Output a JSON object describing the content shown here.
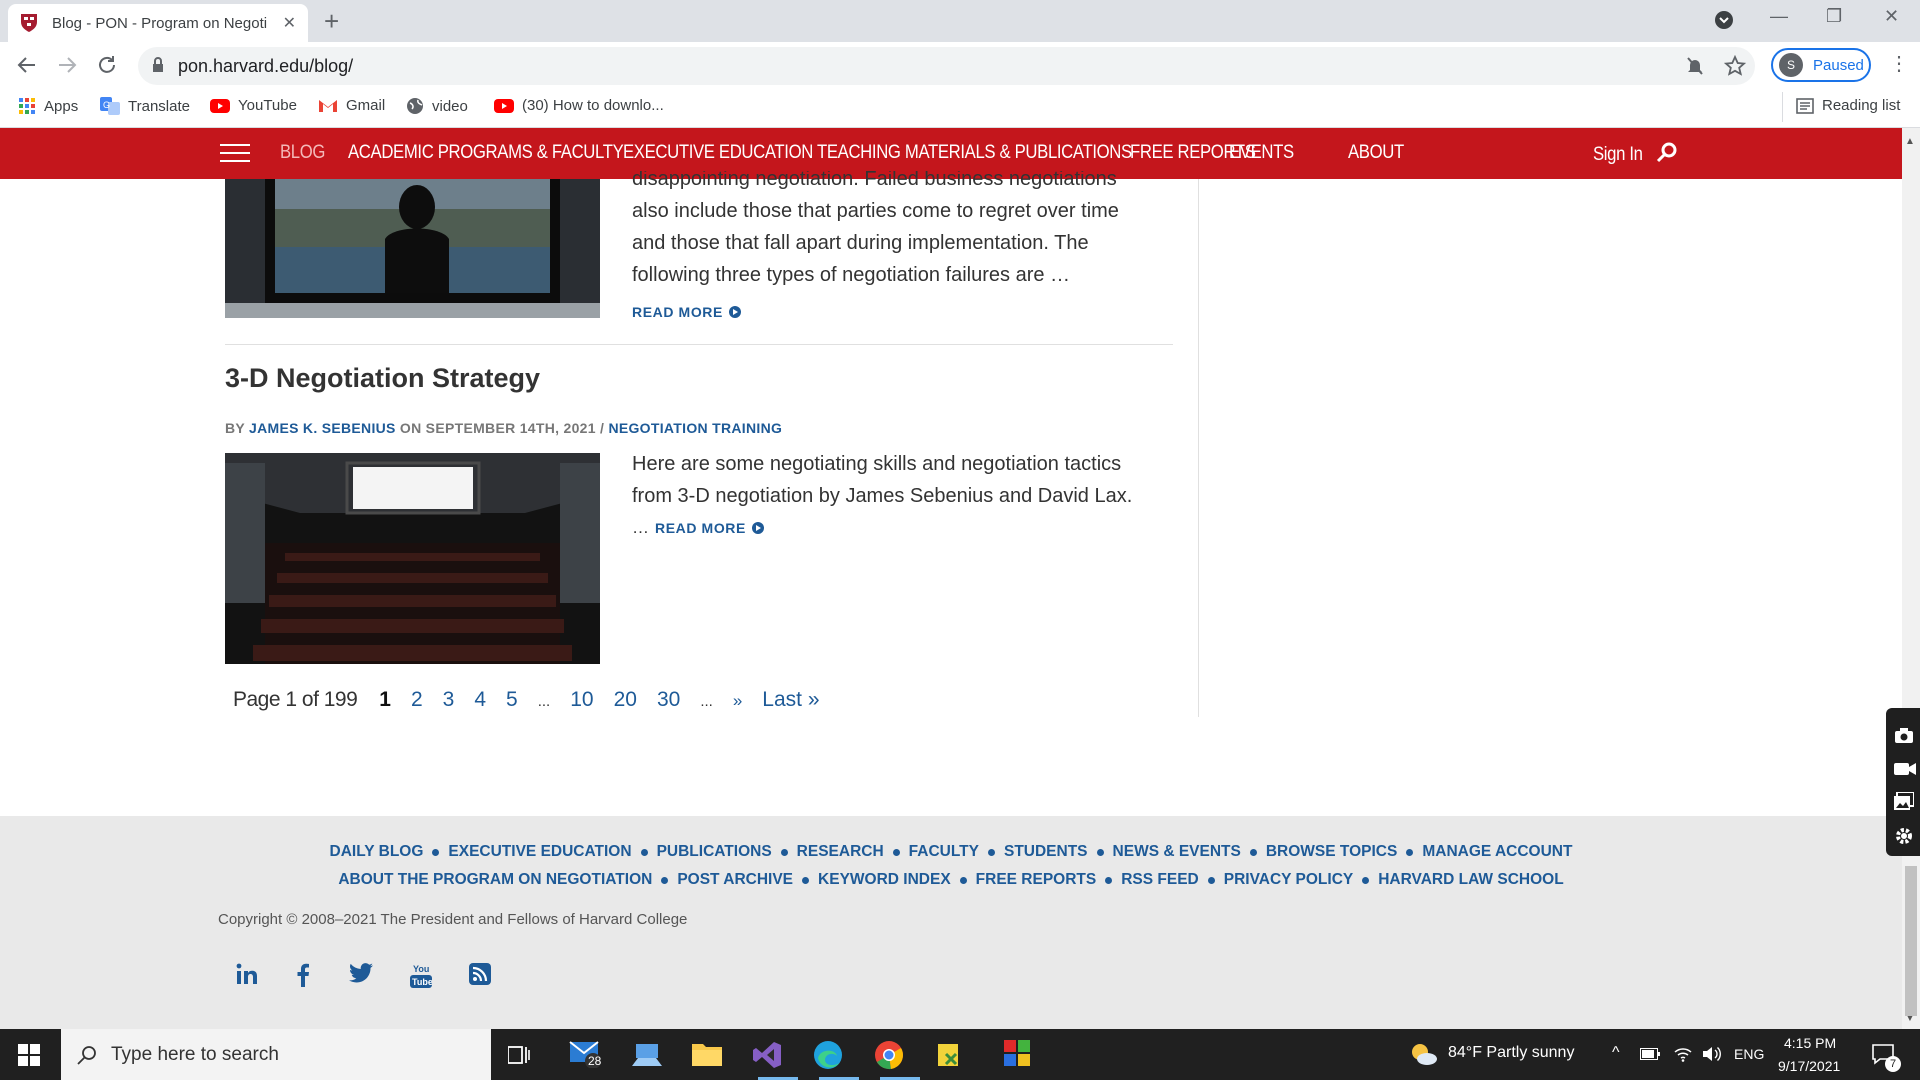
{
  "browser": {
    "tab_title": "Blog - PON - Program on Negoti",
    "url": "pon.harvard.edu/blog/",
    "profile_initial": "S",
    "profile_status": "Paused",
    "bookmarks": [
      "Apps",
      "Translate",
      "YouTube",
      "Gmail",
      "video",
      "(30) How to downlo..."
    ],
    "reading_list": "Reading list"
  },
  "nav": {
    "items": [
      "BLOG",
      "ACADEMIC PROGRAMS & FACULTY",
      "EXECUTIVE EDUCATION",
      "TEACHING MATERIALS & PUBLICATIONS",
      "FREE REPORTS",
      "EVENTS",
      "ABOUT"
    ],
    "sign_in": "Sign In"
  },
  "posts": [
    {
      "excerpt_lines": [
        "disappointing negotiation. Failed business negotiations",
        "also include those that parties come to regret over time",
        "and those that fall apart during implementation. The",
        "following three types of negotiation failures are …"
      ],
      "read_more": "READ MORE"
    },
    {
      "title": "3-D Negotiation Strategy",
      "by": "BY",
      "author": "JAMES K. SEBENIUS",
      "date": "ON SEPTEMBER 14TH, 2021 /",
      "category": "NEGOTIATION TRAINING",
      "excerpt_lines": [
        "Here are some negotiating skills and negotiation tactics",
        "from 3-D negotiation by James Sebenius and David Lax."
      ],
      "ellipsis": "…",
      "read_more": "READ MORE"
    }
  ],
  "pagination": {
    "label": "Page 1 of 199",
    "current": "1",
    "pages": [
      "2",
      "3",
      "4",
      "5"
    ],
    "dots1": "...",
    "jumps": [
      "10",
      "20",
      "30"
    ],
    "dots2": "...",
    "next": "»",
    "last": "Last »"
  },
  "footer": {
    "row1": [
      "DAILY BLOG",
      "EXECUTIVE EDUCATION",
      "PUBLICATIONS",
      "RESEARCH",
      "FACULTY",
      "STUDENTS",
      "NEWS & EVENTS",
      "BROWSE TOPICS",
      "MANAGE ACCOUNT"
    ],
    "row2": [
      "ABOUT THE PROGRAM ON NEGOTIATION",
      "POST ARCHIVE",
      "KEYWORD INDEX",
      "FREE REPORTS",
      "RSS FEED",
      "PRIVACY POLICY",
      "HARVARD LAW SCHOOL"
    ],
    "copyright": "Copyright © 2008–2021 The President and Fellows of Harvard College",
    "social": [
      "linkedin-icon",
      "facebook-icon",
      "twitter-icon",
      "youtube-icon",
      "rss-icon"
    ]
  },
  "taskbar": {
    "search_placeholder": "Type here to search",
    "mail_badge": "28",
    "weather": "84°F  Partly sunny",
    "lang": "ENG",
    "time": "4:15 PM",
    "date": "9/17/2021",
    "notifications": "7"
  },
  "colors": {
    "nav_red": "#c4161c",
    "link_blue": "#1e5a97",
    "footer_bg": "#e9e9e9"
  }
}
